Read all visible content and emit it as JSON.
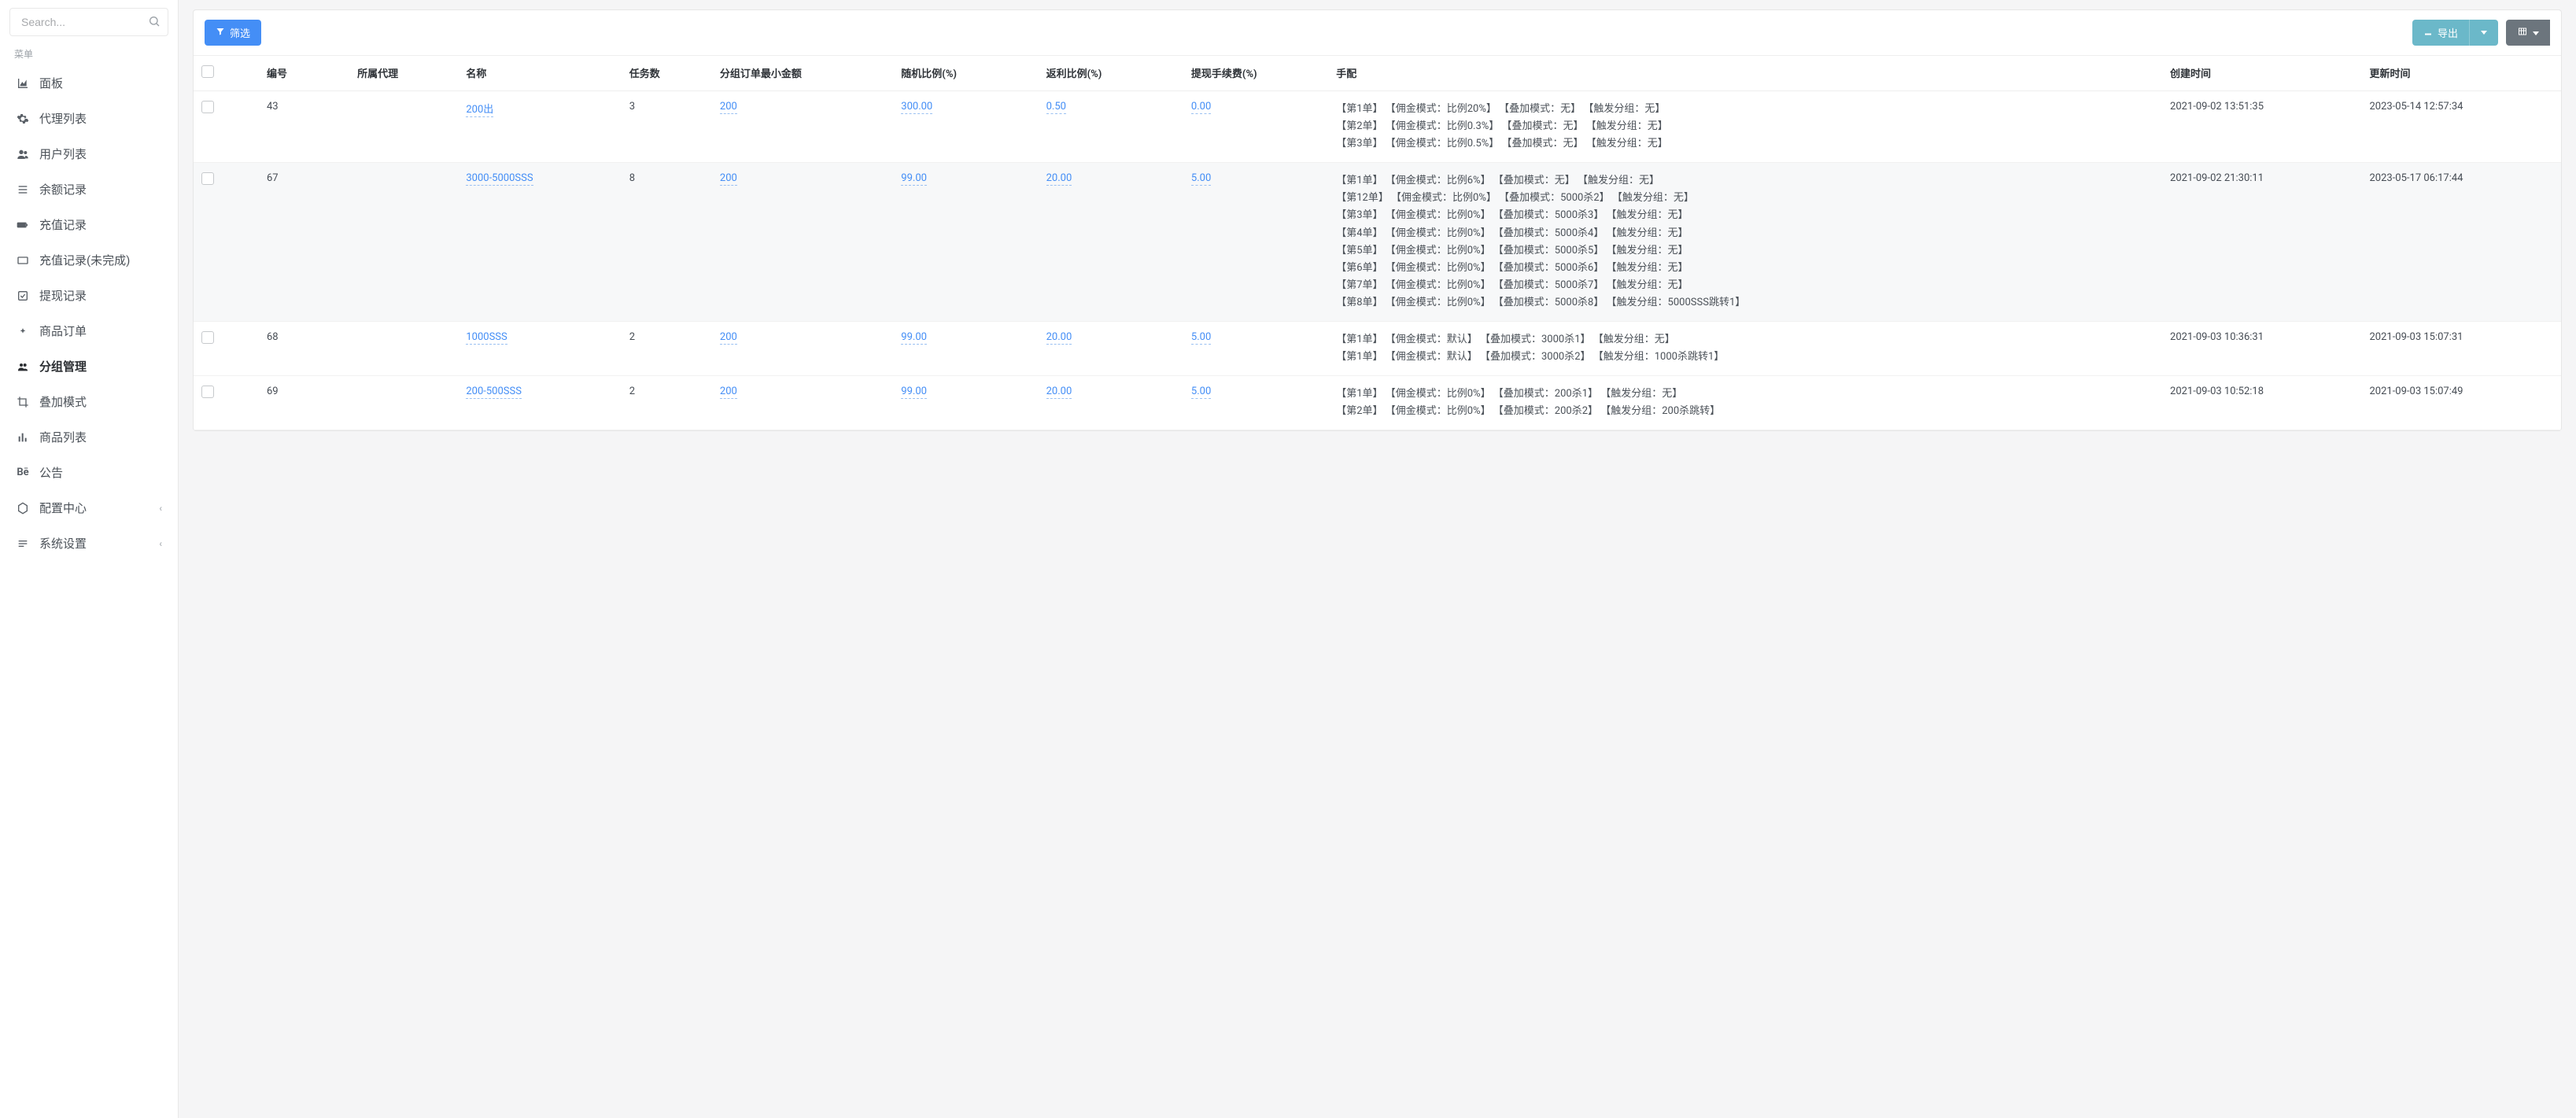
{
  "search": {
    "placeholder": "Search..."
  },
  "menu": {
    "header": "菜单",
    "items": [
      {
        "label": "面板",
        "icon": "chart-area-icon"
      },
      {
        "label": "代理列表",
        "icon": "gear-icon"
      },
      {
        "label": "用户列表",
        "icon": "users-icon"
      },
      {
        "label": "余额记录",
        "icon": "list-icon"
      },
      {
        "label": "充值记录",
        "icon": "battery-icon"
      },
      {
        "label": "充值记录(未完成)",
        "icon": "folder-icon"
      },
      {
        "label": "提现记录",
        "icon": "check-square-icon"
      },
      {
        "label": "商品订单",
        "icon": "dot-icon"
      },
      {
        "label": "分组管理",
        "icon": "users-group-icon",
        "active": true
      },
      {
        "label": "叠加模式",
        "icon": "crop-icon"
      },
      {
        "label": "商品列表",
        "icon": "bar-chart-icon"
      },
      {
        "label": "公告",
        "icon": "behance-icon"
      },
      {
        "label": "配置中心",
        "icon": "hexagon-icon",
        "chevron": true
      },
      {
        "label": "系统设置",
        "icon": "menu-icon",
        "chevron": true
      }
    ]
  },
  "toolbar": {
    "filter": "筛选",
    "export": "导出"
  },
  "table": {
    "headers": {
      "id": "编号",
      "agent": "所属代理",
      "name": "名称",
      "tasks": "任务数",
      "min_amount": "分组订单最小金额",
      "random_ratio": "随机比例(%)",
      "rebate_ratio": "返利比例(%)",
      "withdraw_fee": "提现手续费(%)",
      "hand": "手配",
      "ctime": "创建时间",
      "utime": "更新时间"
    },
    "rows": [
      {
        "id": "43",
        "name": "200出",
        "tasks": "3",
        "min_amount": "200",
        "random_ratio": "300.00",
        "rebate_ratio": "0.50",
        "withdraw_fee": "0.00",
        "hand": "【第1单】 【佣金模式：比例20%】 【叠加模式：无】 【触发分组：无】\n【第2单】 【佣金模式：比例0.3%】 【叠加模式：无】 【触发分组：无】\n【第3单】 【佣金模式：比例0.5%】 【叠加模式：无】 【触发分组：无】",
        "ctime": "2021-09-02 13:51:35",
        "utime": "2023-05-14 12:57:34"
      },
      {
        "id": "67",
        "name": "3000-5000SSS",
        "tasks": "8",
        "min_amount": "200",
        "random_ratio": "99.00",
        "rebate_ratio": "20.00",
        "withdraw_fee": "5.00",
        "hand": "【第1单】 【佣金模式：比例6%】 【叠加模式：无】 【触发分组：无】\n【第12单】 【佣金模式：比例0%】 【叠加模式：5000杀2】 【触发分组：无】\n【第3单】 【佣金模式：比例0%】 【叠加模式：5000杀3】 【触发分组：无】\n【第4单】 【佣金模式：比例0%】 【叠加模式：5000杀4】 【触发分组：无】\n【第5单】 【佣金模式：比例0%】 【叠加模式：5000杀5】 【触发分组：无】\n【第6单】 【佣金模式：比例0%】 【叠加模式：5000杀6】 【触发分组：无】\n【第7单】 【佣金模式：比例0%】 【叠加模式：5000杀7】 【触发分组：无】\n【第8单】 【佣金模式：比例0%】 【叠加模式：5000杀8】 【触发分组：5000SSS跳转1】",
        "ctime": "2021-09-02 21:30:11",
        "utime": "2023-05-17 06:17:44",
        "shade": true
      },
      {
        "id": "68",
        "name": "1000SSS",
        "tasks": "2",
        "min_amount": "200",
        "random_ratio": "99.00",
        "rebate_ratio": "20.00",
        "withdraw_fee": "5.00",
        "hand": "【第1单】 【佣金模式：默认】 【叠加模式：3000杀1】 【触发分组：无】\n【第1单】 【佣金模式：默认】 【叠加模式：3000杀2】 【触发分组：1000杀跳转1】",
        "ctime": "2021-09-03 10:36:31",
        "utime": "2021-09-03 15:07:31"
      },
      {
        "id": "69",
        "name": "200-500SSS",
        "tasks": "2",
        "min_amount": "200",
        "random_ratio": "99.00",
        "rebate_ratio": "20.00",
        "withdraw_fee": "5.00",
        "hand": "【第1单】 【佣金模式：比例0%】 【叠加模式：200杀1】 【触发分组：无】\n【第2单】 【佣金模式：比例0%】 【叠加模式：200杀2】 【触发分组：200杀跳转】",
        "ctime": "2021-09-03 10:52:18",
        "utime": "2021-09-03 15:07:49"
      }
    ]
  }
}
